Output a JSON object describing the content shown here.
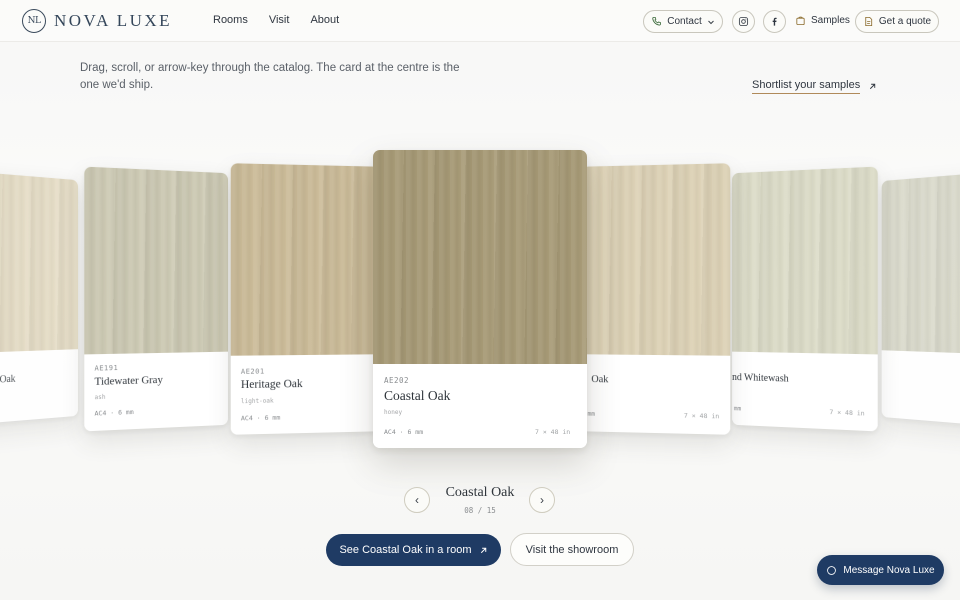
{
  "brand": {
    "monogram": "NL",
    "name": "NOVA LUXE"
  },
  "nav": {
    "rooms": "Rooms",
    "visit": "Visit",
    "about": "About"
  },
  "header_actions": {
    "contact": "Contact",
    "samples": "Samples",
    "quote": "Get a quote"
  },
  "intro": {
    "text": "Drag, scroll, or arrow-key through the catalog. The card at the centre is the one we'd ship.",
    "shortlist": "Shortlist your samples"
  },
  "cards": [
    {
      "code": "",
      "name": "Oak",
      "sub": "",
      "meta": "",
      "meta_r": ""
    },
    {
      "code": "AE191",
      "name": "Tidewater Gray",
      "sub": "ash",
      "meta": "AC4 · 6 mm",
      "meta_r": ""
    },
    {
      "code": "AE201",
      "name": "Heritage Oak",
      "sub": "light-oak",
      "meta": "AC4 · 6 mm",
      "meta_r": ""
    },
    {
      "code": "AE202",
      "name": "Coastal Oak",
      "sub": "honey",
      "meta": "AC4 · 6 mm",
      "meta_r": "7 × 48 in"
    },
    {
      "code": "",
      "name": "Oak",
      "sub": "",
      "meta": "mm",
      "meta_r": "7 × 48 in"
    },
    {
      "code": "",
      "name": "nd Whitewash",
      "sub": "",
      "meta": "mm",
      "meta_r": "7 × 48 in"
    },
    {
      "code": "",
      "name": "",
      "sub": "",
      "meta": "",
      "meta_r": ""
    }
  ],
  "selector": {
    "name": "Coastal Oak",
    "count": "08 / 15",
    "prev": "‹",
    "next": "›"
  },
  "cta": {
    "primary": "See Coastal Oak in a room",
    "secondary": "Visit the showroom"
  },
  "chat": {
    "label": "Message Nova Luxe"
  },
  "colors": {
    "accent_navy": "#1f3b64",
    "underline_tan": "#b08a5a"
  }
}
